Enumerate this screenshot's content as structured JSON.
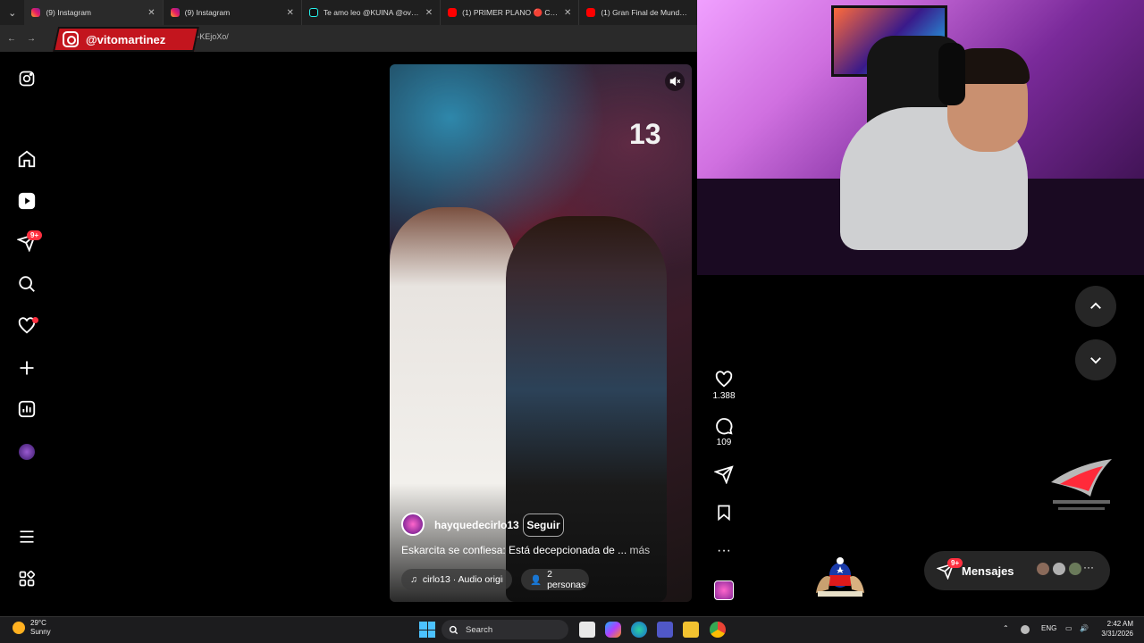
{
  "browser": {
    "tabs": [
      {
        "title": "(9) Instagram",
        "active": true
      },
      {
        "title": "(9) Instagram",
        "active": false
      },
      {
        "title": "Te amo leo @KUINA @ovyze #",
        "active": false
      },
      {
        "title": "(1) PRIMER PLANO 🔴 CAPÍTUL",
        "active": false
      },
      {
        "title": "(1) Gran Final de Mundos O",
        "active": false
      }
    ],
    "url_fragment": "~KEjoXo/"
  },
  "overlay": {
    "handle": "@vitomartinez"
  },
  "nav": {
    "notifications_badge": "9+"
  },
  "reel": {
    "username": "hayquedecirlo13",
    "follow_label": "Seguir",
    "caption": "Eskarcita se confiesa: Está decepcionada de ...",
    "more_label": "más",
    "audio": "cirlo13 · Audio origina",
    "people": "2 personas",
    "banner_number": "13"
  },
  "actions": {
    "likes": "1.388",
    "comments": "109"
  },
  "messages": {
    "label": "Mensajes",
    "badge": "9+",
    "more": "···"
  },
  "taskbar": {
    "temp": "29°C",
    "condition": "Sunny",
    "search_placeholder": "Search",
    "lang": "ENG",
    "time": "2:42 AM",
    "date": "3/31/2026"
  }
}
